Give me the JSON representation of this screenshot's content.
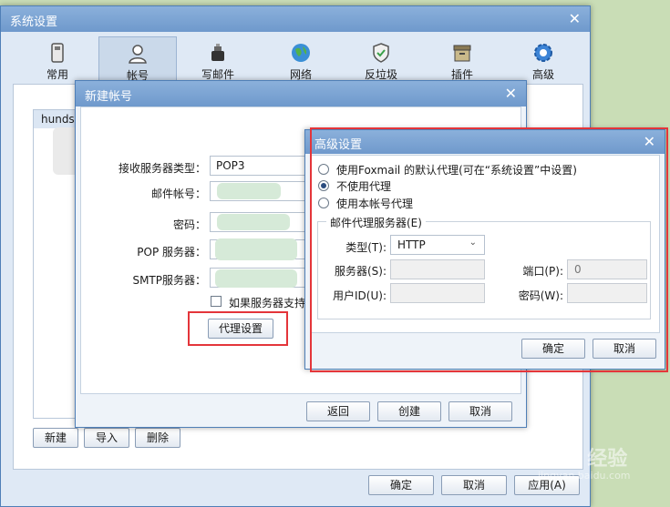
{
  "main_window": {
    "title": "系统设置",
    "tabs": [
      {
        "label": "常用",
        "icon": "phone-icon"
      },
      {
        "label": "帐号",
        "icon": "person-icon"
      },
      {
        "label": "写邮件",
        "icon": "inkwell-icon"
      },
      {
        "label": "网络",
        "icon": "globe-icon"
      },
      {
        "label": "反垃圾",
        "icon": "shield-icon"
      },
      {
        "label": "插件",
        "icon": "box-icon"
      },
      {
        "label": "高级",
        "icon": "gear-icon"
      }
    ],
    "account_list_item": "hunds",
    "bottom_buttons": {
      "new": "新建",
      "import": "导入",
      "delete": "删除"
    },
    "footer_buttons": {
      "ok": "确定",
      "cancel": "取消",
      "apply": "应用(A)"
    }
  },
  "new_account_dialog": {
    "title": "新建帐号",
    "receive_server_type_label": "接收服务器类型：",
    "receive_server_type_value": "POP3",
    "email_label": "邮件帐号：",
    "password_label": "密码：",
    "pop_label": "POP 服务器：",
    "smtp_label": "SMTP服务器：",
    "checkbox_label": "如果服务器支持",
    "proxy_button": "代理设置",
    "buttons": {
      "back": "返回",
      "create": "创建",
      "cancel": "取消"
    }
  },
  "advanced_dialog": {
    "title": "高级设置",
    "radio_options": [
      "使用Foxmail 的默认代理(可在“系统设置”中设置)",
      "不使用代理",
      "使用本帐号代理"
    ],
    "selected_option": "不使用代理",
    "group_title": "邮件代理服务器(E)",
    "type_label": "类型(T):",
    "type_value": "HTTP",
    "server_label": "服务器(S):",
    "port_label": "端口(P):",
    "port_value": "0",
    "userid_label": "用户ID(U):",
    "password_label": "密码(W):",
    "buttons": {
      "ok": "确定",
      "cancel": "取消"
    }
  },
  "watermark": {
    "text": "Baidu 经验",
    "sub": "jingyan.baidu.com"
  },
  "colors": {
    "annotation_red": "#e4353a",
    "titlebar_blue": "#7aa3d4"
  }
}
